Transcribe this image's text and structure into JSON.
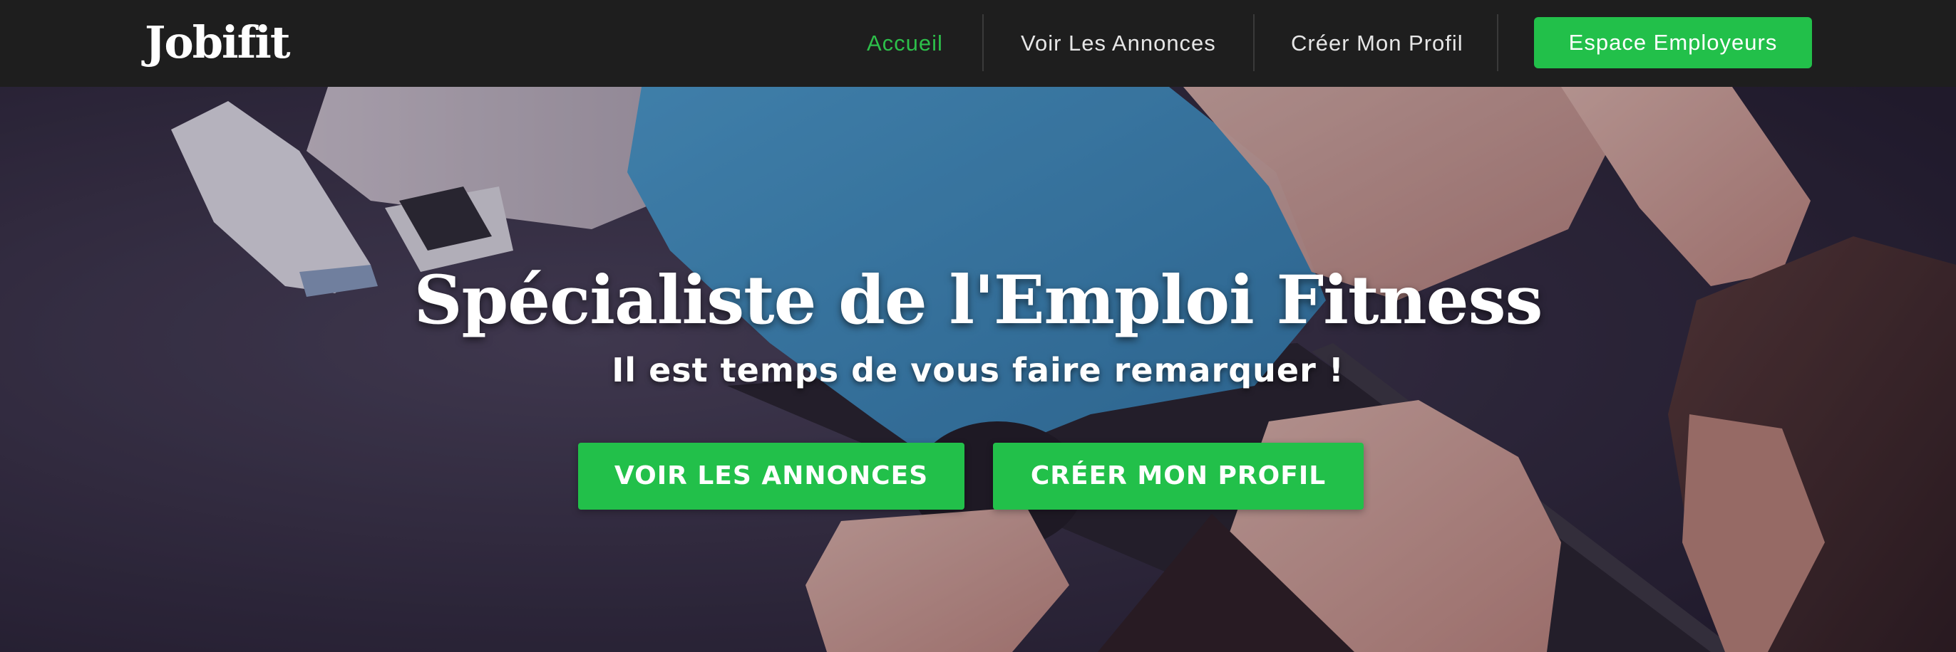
{
  "brand": {
    "logo_text": "Jobifit",
    "accent_color": "#22c04a",
    "navbar_color": "#1e1e1e"
  },
  "nav": {
    "items": [
      {
        "label": "Accueil",
        "active": true
      },
      {
        "label": "Voir Les Annonces",
        "active": false
      },
      {
        "label": "Créer Mon Profil",
        "active": false
      }
    ],
    "cta_label": "Espace Employeurs"
  },
  "hero": {
    "title": "Spécialiste de l'Emploi Fitness",
    "subtitle": "Il est temps de vous faire remarquer !",
    "primary_button": "VOIR LES ANNONCES",
    "secondary_button": "CRÉER MON PROFIL",
    "background": "fitness-training-photo"
  }
}
